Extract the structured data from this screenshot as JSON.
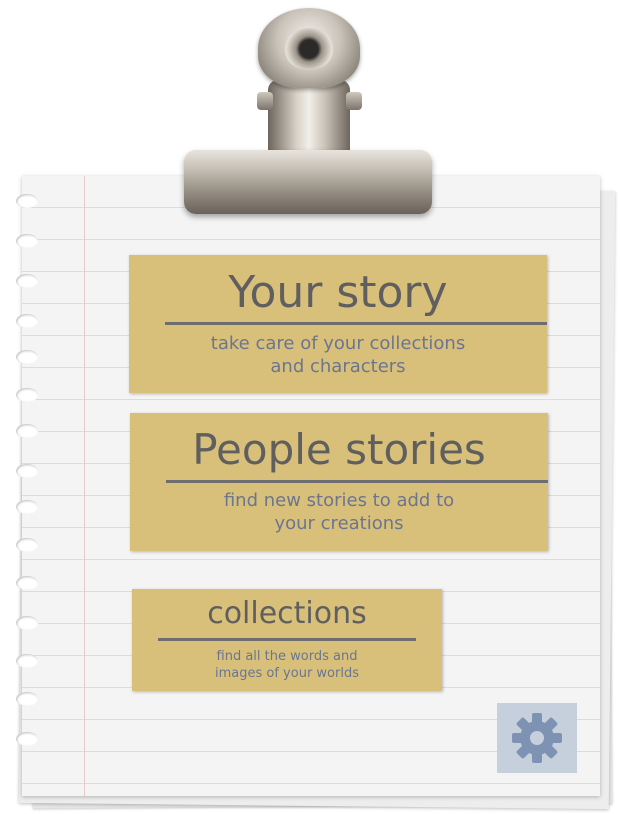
{
  "cards": {
    "your_story": {
      "title": "Your story",
      "subtitle_line1": "take care of your collections",
      "subtitle_line2": "and characters"
    },
    "people_stories": {
      "title": "People stories",
      "subtitle_line1": "find new stories to add to",
      "subtitle_line2": "your creations"
    },
    "collections": {
      "title": "collections",
      "subtitle_line1": "find all the words and",
      "subtitle_line2": "images of your worlds"
    }
  },
  "settings": {
    "icon": "gear-icon"
  },
  "colors": {
    "card": "#d8c07a",
    "title_text": "#5f5f60",
    "subtitle_text": "#6b7590",
    "settings_bg": "#c6d0dd",
    "gear": "#7e93b3"
  }
}
